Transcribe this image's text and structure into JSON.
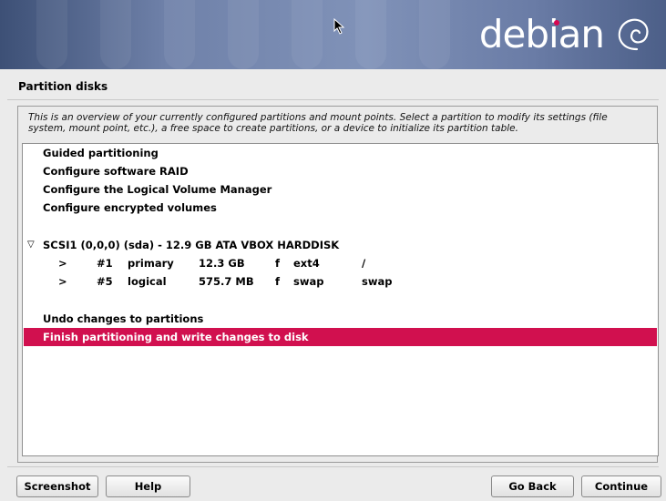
{
  "banner": {
    "logo_text": "debian"
  },
  "page": {
    "title": "Partition disks",
    "description": "This is an overview of your currently configured partitions and mount points. Select a partition to modify its settings (file system, mount point, etc.), a free space to create partitions, or a device to initialize its partition table."
  },
  "menu": {
    "guided": "Guided partitioning",
    "raid": "Configure software RAID",
    "lvm": "Configure the Logical Volume Manager",
    "encrypted": "Configure encrypted volumes",
    "disk": {
      "arrow": "▽",
      "label": "SCSI1 (0,0,0) (sda) - 12.9 GB ATA VBOX HARDDISK"
    },
    "partitions": [
      {
        "marker": ">",
        "number": "#1",
        "type": "primary",
        "size": "12.3 GB",
        "flag": "f",
        "fs": "ext4",
        "mount": "/"
      },
      {
        "marker": ">",
        "number": "#5",
        "type": "logical",
        "size": "575.7 MB",
        "flag": "f",
        "fs": "swap",
        "mount": "swap"
      }
    ],
    "undo": "Undo changes to partitions",
    "finish": "Finish partitioning and write changes to disk"
  },
  "buttons": {
    "screenshot": "Screenshot",
    "help": "Help",
    "go_back": "Go Back",
    "continue": "Continue"
  },
  "colors": {
    "selection": "#d1104f",
    "banner": "#6f81a9"
  }
}
